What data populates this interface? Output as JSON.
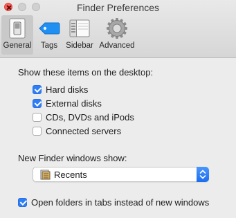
{
  "window": {
    "title": "Finder Preferences"
  },
  "toolbar": {
    "tabs": [
      {
        "label": "General",
        "icon": "switch-icon",
        "selected": true
      },
      {
        "label": "Tags",
        "icon": "tag-icon",
        "selected": false
      },
      {
        "label": "Sidebar",
        "icon": "sidebar-icon",
        "selected": false
      },
      {
        "label": "Advanced",
        "icon": "gear-icon",
        "selected": false
      }
    ]
  },
  "desktop": {
    "heading": "Show these items on the desktop:",
    "items": [
      {
        "label": "Hard disks",
        "checked": true
      },
      {
        "label": "External disks",
        "checked": true
      },
      {
        "label": "CDs, DVDs and iPods",
        "checked": false
      },
      {
        "label": "Connected servers",
        "checked": false
      }
    ]
  },
  "new_window": {
    "heading": "New Finder windows show:",
    "selected": "Recents"
  },
  "tabs_option": {
    "label": "Open folders in tabs instead of new windows",
    "checked": true
  },
  "colors": {
    "accent": "#2d7ef7",
    "close": "#fc5f57",
    "tag_blue": "#1f8ff2"
  }
}
